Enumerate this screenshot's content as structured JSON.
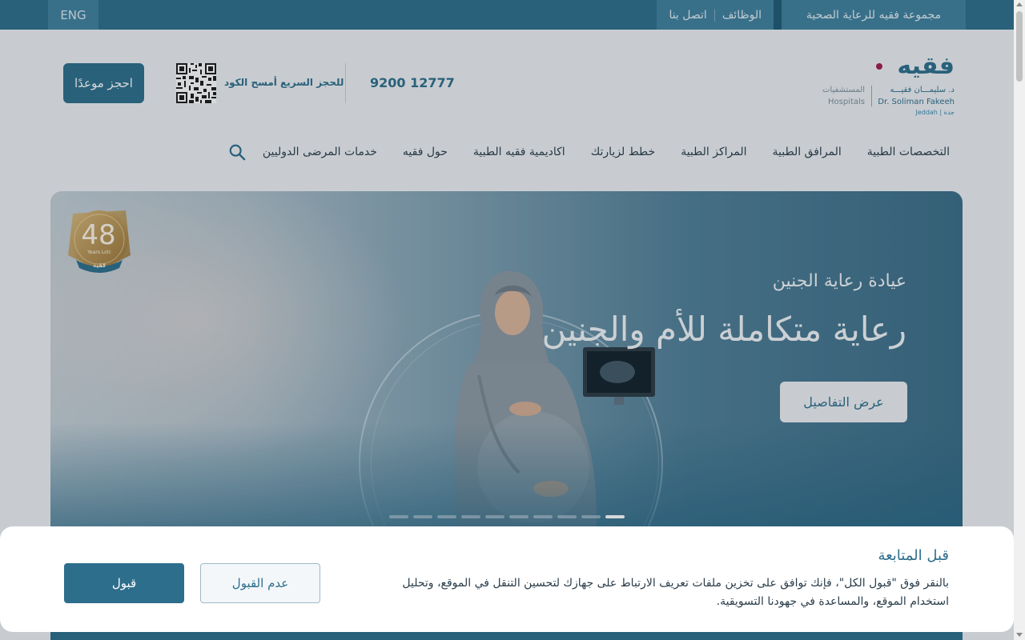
{
  "topbar": {
    "lang_label": "ENG",
    "group_link": "مجموعة فقيه للرعاية الصحية",
    "links": [
      "الوظائف",
      "اتصل بنا"
    ]
  },
  "logo": {
    "brand": "فقيه",
    "name_ar": "د. سليمـــان فقيـــه",
    "name_en": "Dr. Soliman Fakeeh",
    "city": "Jeddah | جدة",
    "hospitals_ar": "المستشفيات",
    "hospitals_en": "Hospitals"
  },
  "header": {
    "phone": "9200 12777",
    "qr_label": "للحجز السريع أمسح الكود",
    "book_label": "احجز موعدًا"
  },
  "nav": {
    "items": [
      "التخصصات الطبية",
      "المرافق الطبية",
      "المراكز الطبية",
      "خطط لزيارتك",
      "اكاديمية فقيه الطبية",
      "حول فقيه",
      "خدمات المرضى الدوليين"
    ]
  },
  "hero": {
    "subtitle": "عيادة رعاية الجنين",
    "title": "رعاية متكاملة للأم والجنين",
    "button": "عرض التفاصيل",
    "badge_number": "48",
    "badge_text": "Years Lolc",
    "badge_brand": "فقيه",
    "slides_count": 10,
    "active_slide": 10
  },
  "cookie": {
    "title": "قبل المتابعة",
    "text": "بالنقر فوق \"قبول الكل\"، فإنك توافق على تخزين ملفات تعريف الارتباط على جهازك لتحسين التنقل في الموقع، وتحليل استخدام الموقع، والمساعدة في جهودنا التسويقية.",
    "reject_label": "عدم القبول",
    "accept_label": "قبول"
  },
  "colors": {
    "primary": "#2d6e8c",
    "accent_dot": "#a11d4e",
    "badge_gold": "#b8924a"
  }
}
